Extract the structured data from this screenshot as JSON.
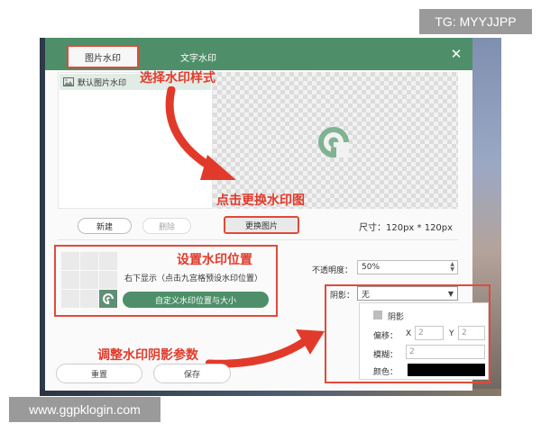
{
  "overlay": {
    "tg_label": "TG: MYYJJPP",
    "site_label": "www.ggpklogin.com"
  },
  "dialog": {
    "tabs": [
      {
        "label": "图片水印",
        "active": true
      },
      {
        "label": "文字水印",
        "active": false
      }
    ],
    "close_glyph": "✕",
    "accent_color": "#4e8f69"
  },
  "image_panel": {
    "list_item_label": "默认图片水印",
    "new_button": "新建",
    "delete_button": "删除",
    "replace_button": "更换图片",
    "size_label": "尺寸：120px * 120px"
  },
  "position": {
    "description": "右下显示（点击九宫格预设水印位置）",
    "custom_button": "自定义水印位置与大小",
    "selected_cell": 9
  },
  "opacity": {
    "label": "不透明度：",
    "value": "50%"
  },
  "shadow": {
    "label": "阴影：",
    "value": "无",
    "checkbox_label": "阴影",
    "offset_label": "偏移：",
    "x_label": "X",
    "x_value": "2",
    "y_label": "Y",
    "y_value": "2",
    "blur_label": "模糊：",
    "blur_value": "2",
    "color_label": "颜色：",
    "color_value": "#000000"
  },
  "footer": {
    "reset_button": "重置",
    "save_button": "保存"
  },
  "annotations": {
    "select_style": "选择水印样式",
    "replace_image": "点击更换水印图",
    "set_position": "设置水印位置",
    "adjust_shadow": "调整水印阴影参数",
    "color": "#e23a2a"
  }
}
